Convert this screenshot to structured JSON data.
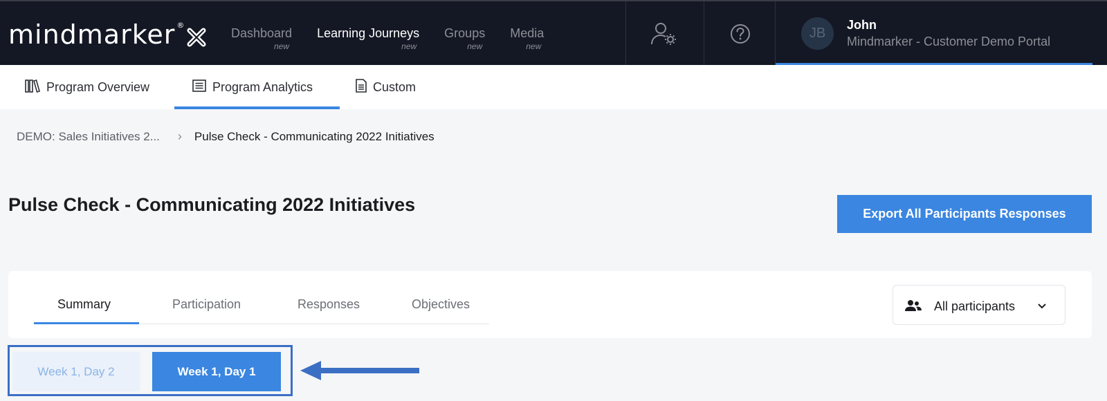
{
  "header": {
    "logo_text": "mindmarker",
    "logo_reg": "®",
    "nav": [
      {
        "label": "Dashboard",
        "badge": "new",
        "active": false
      },
      {
        "label": "Learning Journeys",
        "badge": "new",
        "active": true
      },
      {
        "label": "Groups",
        "badge": "new",
        "active": false
      },
      {
        "label": "Media",
        "badge": "new",
        "active": false
      }
    ],
    "icons": [
      "user-settings-icon",
      "help-icon"
    ],
    "user": {
      "initials": "JB",
      "name": "John",
      "portal": "Mindmarker - Customer Demo Portal"
    }
  },
  "subnav": {
    "tabs": [
      {
        "label": "Program Overview",
        "icon": "books-icon",
        "active": false
      },
      {
        "label": "Program Analytics",
        "icon": "list-icon",
        "active": true
      },
      {
        "label": "Custom",
        "icon": "document-icon",
        "active": false
      }
    ]
  },
  "breadcrumb": {
    "parent": "DEMO: Sales Initiatives 2...",
    "separator": "›",
    "current": "Pulse Check - Communicating 2022 Initiatives"
  },
  "page": {
    "title": "Pulse Check - Communicating 2022 Initiatives",
    "export_label": "Export All Participants Responses"
  },
  "analytics": {
    "tabs": [
      {
        "label": "Summary",
        "active": true
      },
      {
        "label": "Participation",
        "active": false
      },
      {
        "label": "Responses",
        "active": false
      },
      {
        "label": "Objectives",
        "active": false
      }
    ],
    "filter": {
      "icon": "participants-icon",
      "selected": "All participants"
    }
  },
  "weeks": [
    {
      "label": "Week 1, Day 2",
      "selected": false
    },
    {
      "label": "Week 1, Day 1",
      "selected": true
    }
  ],
  "colors": {
    "topbar": "#141824",
    "accent": "#3a86e0",
    "annotation": "#3b6fc4",
    "background": "#f5f6f8"
  }
}
